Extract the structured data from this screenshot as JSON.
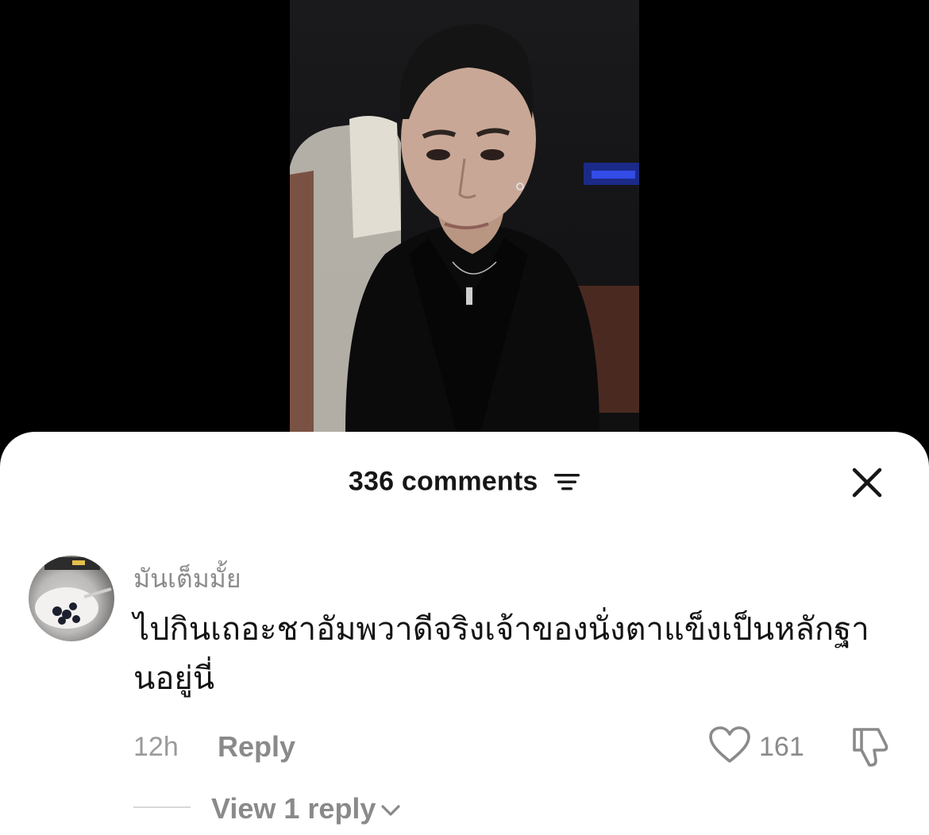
{
  "video": {
    "description": "",
    "colors": {
      "background": "#000000"
    }
  },
  "comments_panel": {
    "count_label": "336 comments",
    "icons": {
      "filter": "filter-icon",
      "close": "close-icon"
    }
  },
  "comment": {
    "username": "มันเต็มมั้ย",
    "text": "ไปกินเถอะชาอัมพวาดีจริงเจ้าของนั่งตาแข็งเป็นหลักฐานอยู่นี่",
    "timestamp": "12h",
    "reply_label": "Reply",
    "like_count": "161",
    "view_replies_label": "View 1 reply",
    "icons": {
      "like": "heart-icon",
      "dislike": "thumbs-down-icon",
      "expand": "chevron-down-icon"
    }
  }
}
